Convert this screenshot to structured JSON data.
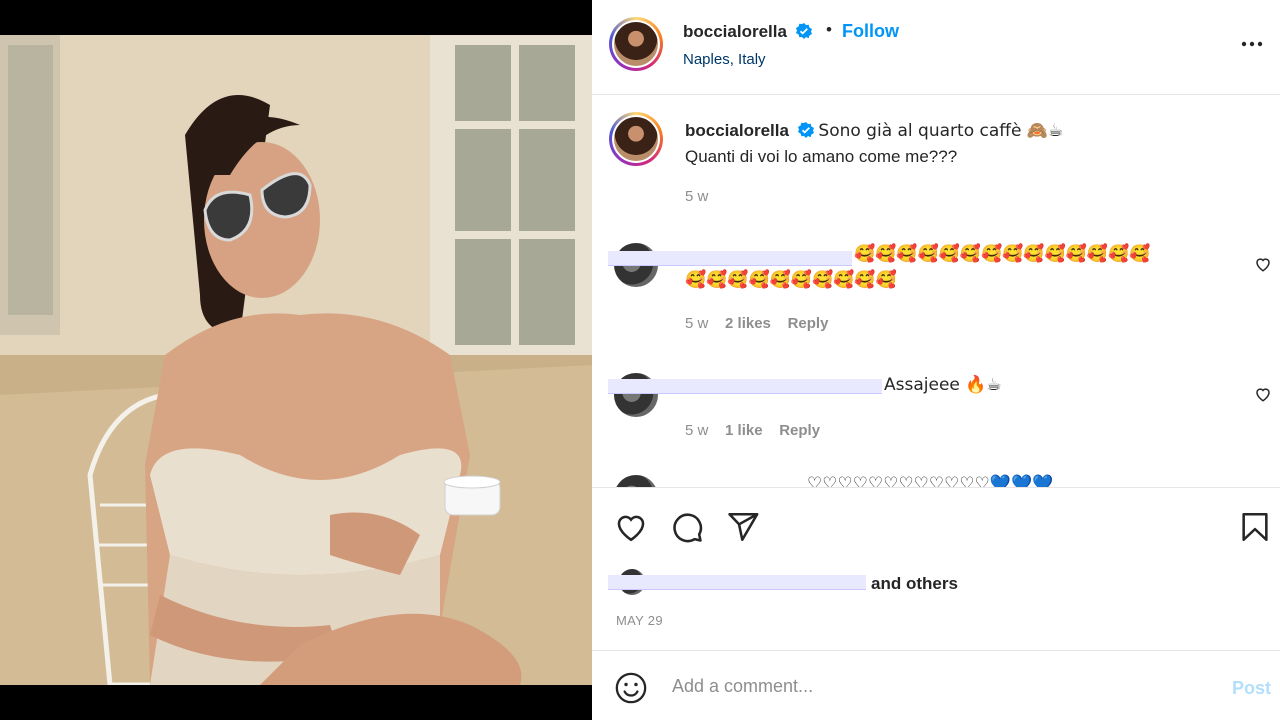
{
  "post": {
    "username": "boccialorella",
    "follow_label": "Follow",
    "dot": "•",
    "location": "Naples, Italy"
  },
  "caption": {
    "username": "boccialorella",
    "line1": "Sono già al quarto caffè 🙈☕",
    "line2": "Quanti di voi lo amano come me???",
    "time": "5 w"
  },
  "comments": [
    {
      "text_line1": "🥰🥰🥰🥰🥰🥰🥰🥰🥰🥰🥰🥰🥰🥰",
      "text_line2": "🥰🥰🥰🥰🥰🥰🥰🥰🥰🥰",
      "time": "5 w",
      "likes": "2 likes",
      "reply": "Reply"
    },
    {
      "text_line1": "Assajeee 🔥☕",
      "time": "5 w",
      "likes": "1 like",
      "reply": "Reply"
    },
    {
      "text_line1": "♡♡♡♡♡♡♡♡♡♡♡♡💙💙💙"
    }
  ],
  "likes_summary": {
    "suffix": "and others",
    "date": "MAY 29"
  },
  "add_comment": {
    "placeholder": "Add a comment...",
    "post_label": "Post"
  },
  "colors": {
    "accent": "#0095f6",
    "post_disabled": "#b2dffc",
    "redaction": "#e8e8ff"
  },
  "icons": [
    "verified-badge-icon",
    "more-options-icon",
    "heart-icon",
    "comment-icon",
    "share-icon",
    "bookmark-icon",
    "emoji-icon"
  ]
}
